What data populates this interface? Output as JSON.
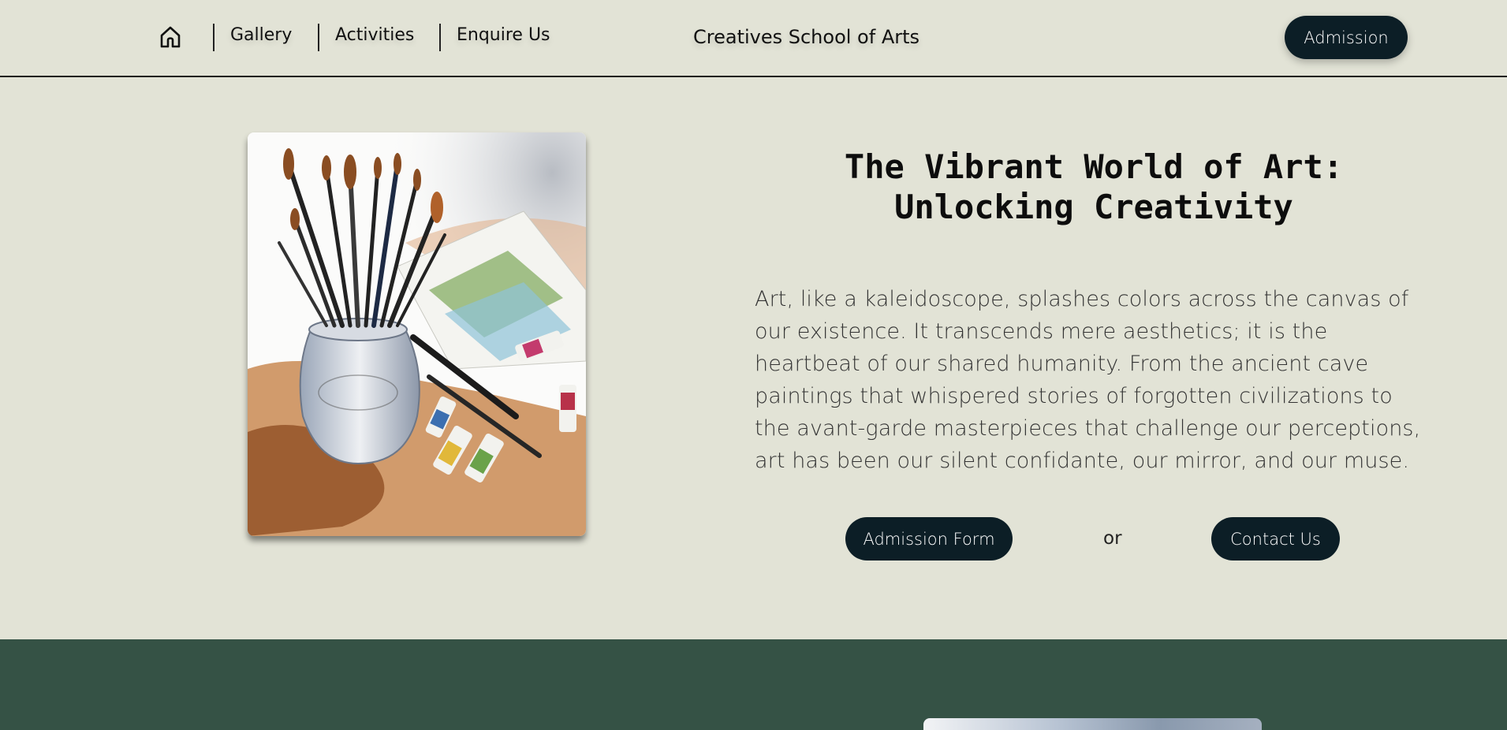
{
  "nav": {
    "links": [
      {
        "label": "Gallery"
      },
      {
        "label": "Activities"
      },
      {
        "label": "Enquire Us"
      }
    ],
    "site_title": "Creatives School of Arts",
    "admission_label": "Admission"
  },
  "hero": {
    "title_line1": "The Vibrant World of Art:",
    "title_line2": "Unlocking Creativity",
    "body": "Art, like a kaleidoscope, splashes colors across the canvas of our existence. It transcends mere aesthetics; it is the heartbeat of our shared humanity. From the ancient cave paintings that whispered stories of forgotten civilizations to the avant-garde masterpieces that challenge our perceptions, art has been our silent confidante, our mirror, and our muse.",
    "form_button": "Admission Form",
    "or_text": "or",
    "contact_button": "Contact Us"
  },
  "colors": {
    "background": "#e2e3d6",
    "button": "#0c1e26",
    "section_dark": "#355245"
  },
  "icons": {
    "home": "home-icon"
  }
}
